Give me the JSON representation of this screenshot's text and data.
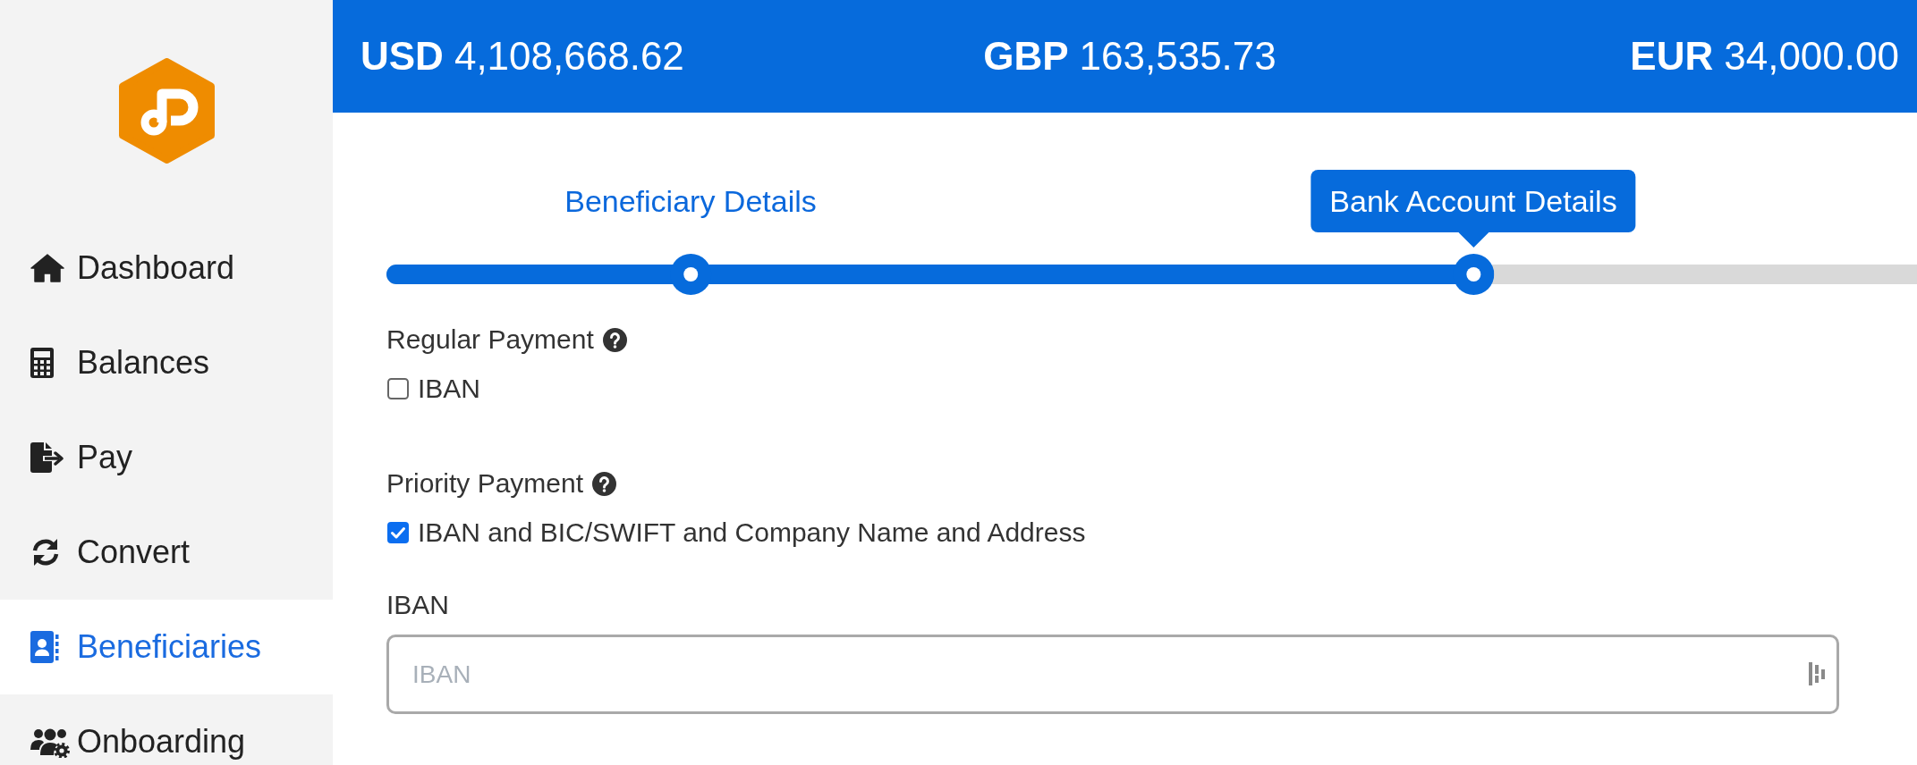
{
  "sidebar": {
    "items": [
      {
        "label": "Dashboard",
        "selected": false
      },
      {
        "label": "Balances",
        "selected": false
      },
      {
        "label": "Pay",
        "selected": false
      },
      {
        "label": "Convert",
        "selected": false
      },
      {
        "label": "Beneficiaries",
        "selected": true
      },
      {
        "label": "Onboarding",
        "selected": false
      }
    ]
  },
  "balances": [
    {
      "currency": "USD",
      "amount": "4,108,668.62"
    },
    {
      "currency": "GBP",
      "amount": "163,535.73"
    },
    {
      "currency": "EUR",
      "amount": "34,000.00"
    }
  ],
  "stepper": {
    "steps": [
      {
        "label": "Beneficiary Details",
        "selected": false
      },
      {
        "label": "Bank Account Details",
        "selected": true
      }
    ],
    "level": 0.71
  },
  "payment_types": [
    {
      "title": "Regular Payment",
      "option": "IBAN",
      "checked": false
    },
    {
      "title": "Priority Payment",
      "option": "IBAN and BIC/SWIFT and Company Name and Address",
      "checked": true
    }
  ],
  "iban_field": {
    "label": "IBAN",
    "placeholder": "IBAN"
  }
}
